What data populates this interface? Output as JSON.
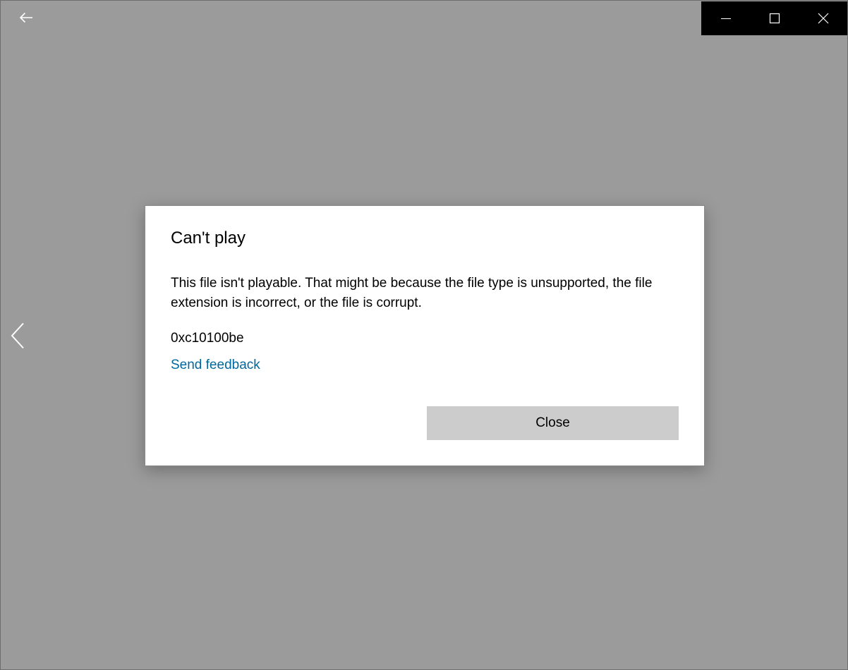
{
  "window": {
    "background_color": "#9b9b9b",
    "back_icon": "arrow-left-icon",
    "caption_buttons": {
      "minimize_icon": "minimize-icon",
      "maximize_icon": "maximize-icon",
      "close_icon": "close-icon",
      "background_color": "#000000"
    },
    "prev_icon": "chevron-left-icon"
  },
  "dialog": {
    "title": "Can't play",
    "message": "This file isn't playable. That might be because the file type is unsupported, the file extension is incorrect, or the file is corrupt.",
    "error_code": "0xc10100be",
    "feedback_link": "Send feedback",
    "close_button": "Close",
    "link_color": "#00689e",
    "button_color": "#cccccc"
  }
}
